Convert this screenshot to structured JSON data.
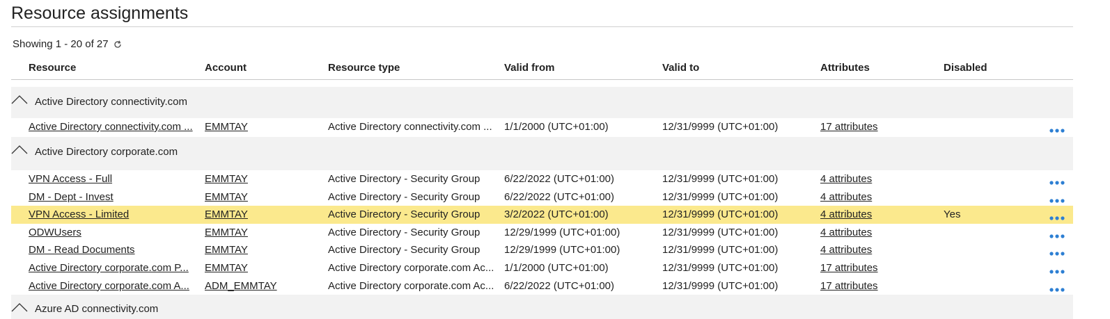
{
  "page": {
    "title": "Resource assignments",
    "showing": "Showing 1 - 20 of 27"
  },
  "columns": {
    "resource": "Resource",
    "account": "Account",
    "resource_type": "Resource type",
    "valid_from": "Valid from",
    "valid_to": "Valid to",
    "attributes": "Attributes",
    "disabled": "Disabled"
  },
  "groups": [
    {
      "title": "Active Directory connectivity.com",
      "rows": [
        {
          "resource": "Active Directory connectivity.com ...",
          "account": "EMMTAY",
          "type": "Active Directory connectivity.com ...",
          "from": "1/1/2000 (UTC+01:00)",
          "to": "12/31/9999 (UTC+01:00)",
          "attributes": "17 attributes",
          "disabled": ""
        }
      ]
    },
    {
      "title": "Active Directory corporate.com",
      "rows": [
        {
          "resource": "VPN Access - Full",
          "account": "EMMTAY",
          "type": "Active Directory - Security Group",
          "from": "6/22/2022 (UTC+01:00)",
          "to": "12/31/9999 (UTC+01:00)",
          "attributes": "4 attributes",
          "disabled": ""
        },
        {
          "resource": "DM - Dept - Invest",
          "account": "EMMTAY",
          "type": "Active Directory - Security Group",
          "from": "6/22/2022 (UTC+01:00)",
          "to": "12/31/9999 (UTC+01:00)",
          "attributes": "4 attributes",
          "disabled": ""
        },
        {
          "resource": "VPN Access - Limited",
          "account": "EMMTAY",
          "type": "Active Directory - Security Group",
          "from": "3/2/2022 (UTC+01:00)",
          "to": "12/31/9999 (UTC+01:00)",
          "attributes": "4 attributes",
          "disabled": "Yes"
        },
        {
          "resource": "ODWUsers",
          "account": "EMMTAY",
          "type": "Active Directory - Security Group",
          "from": "12/29/1999 (UTC+01:00)",
          "to": "12/31/9999 (UTC+01:00)",
          "attributes": "4 attributes",
          "disabled": ""
        },
        {
          "resource": "DM - Read Documents",
          "account": "EMMTAY",
          "type": "Active Directory - Security Group",
          "from": "12/29/1999 (UTC+01:00)",
          "to": "12/31/9999 (UTC+01:00)",
          "attributes": "4 attributes",
          "disabled": ""
        },
        {
          "resource": "Active Directory corporate.com P...",
          "account": "EMMTAY",
          "type": "Active Directory corporate.com Ac...",
          "from": "1/1/2000 (UTC+01:00)",
          "to": "12/31/9999 (UTC+01:00)",
          "attributes": "17 attributes",
          "disabled": ""
        },
        {
          "resource": "Active Directory corporate.com A...",
          "account": "ADM_EMMTAY",
          "type": "Active Directory corporate.com Ac...",
          "from": "6/22/2022 (UTC+01:00)",
          "to": "12/31/9999 (UTC+01:00)",
          "attributes": "17 attributes",
          "disabled": ""
        }
      ]
    },
    {
      "title": "Azure AD connectivity.com",
      "rows": []
    }
  ],
  "icons": {
    "refresh": "refresh-icon",
    "group_toggle": "chevron-up-icon",
    "row_menu": "more-horizontal-icon"
  },
  "colors": {
    "highlight_row": "#fbe98d",
    "group_background": "#f2f2f2",
    "menu_dots": "#2d7fd3"
  }
}
